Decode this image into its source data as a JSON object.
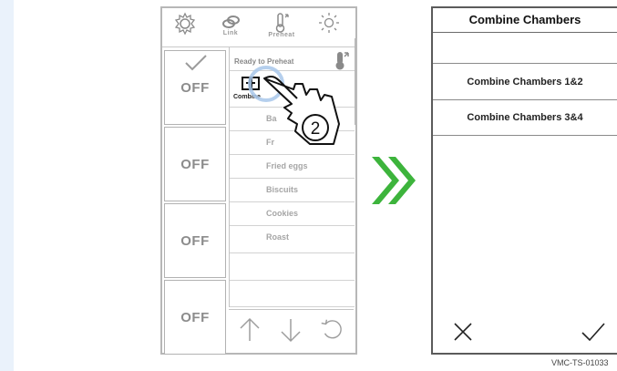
{
  "toolbar": {
    "link_label": "Link",
    "preheat_label": "Preheat"
  },
  "chambers": [
    {
      "state": "OFF",
      "selected": true
    },
    {
      "state": "OFF",
      "selected": false
    },
    {
      "state": "OFF",
      "selected": false
    },
    {
      "state": "OFF",
      "selected": false
    }
  ],
  "menu": {
    "status": "Ready to Preheat",
    "combine_label": "Combine",
    "items": [
      "Ba",
      "Fr",
      "Fried eggs",
      "Biscuits",
      "Cookies",
      "Roast"
    ]
  },
  "callout": {
    "step_number": "2"
  },
  "dialog": {
    "title": "Combine Chambers",
    "options": [
      "Combine Chambers 1&2",
      "Combine Chambers 3&4"
    ],
    "cancel_icon": "close-icon",
    "confirm_icon": "check-icon"
  },
  "figure_code": "VMC-TS-01033",
  "colors": {
    "accent_green": "#3db43c",
    "border_gray": "#b7b7b7"
  }
}
